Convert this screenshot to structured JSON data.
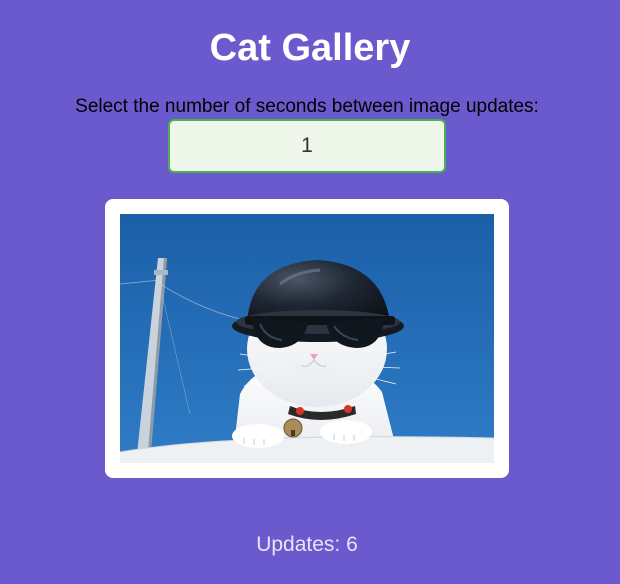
{
  "page": {
    "title": "Cat Gallery"
  },
  "controls": {
    "prompt": "Select the number of seconds between image updates:",
    "seconds_value": "1"
  },
  "gallery": {
    "image_alt": "cat wearing a helmet and sunglasses"
  },
  "status": {
    "updates_label": "Updates:",
    "updates_count": "6"
  },
  "colors": {
    "background": "#6a5acd",
    "input_border": "#4caf50",
    "input_fill": "#eff7ea"
  }
}
